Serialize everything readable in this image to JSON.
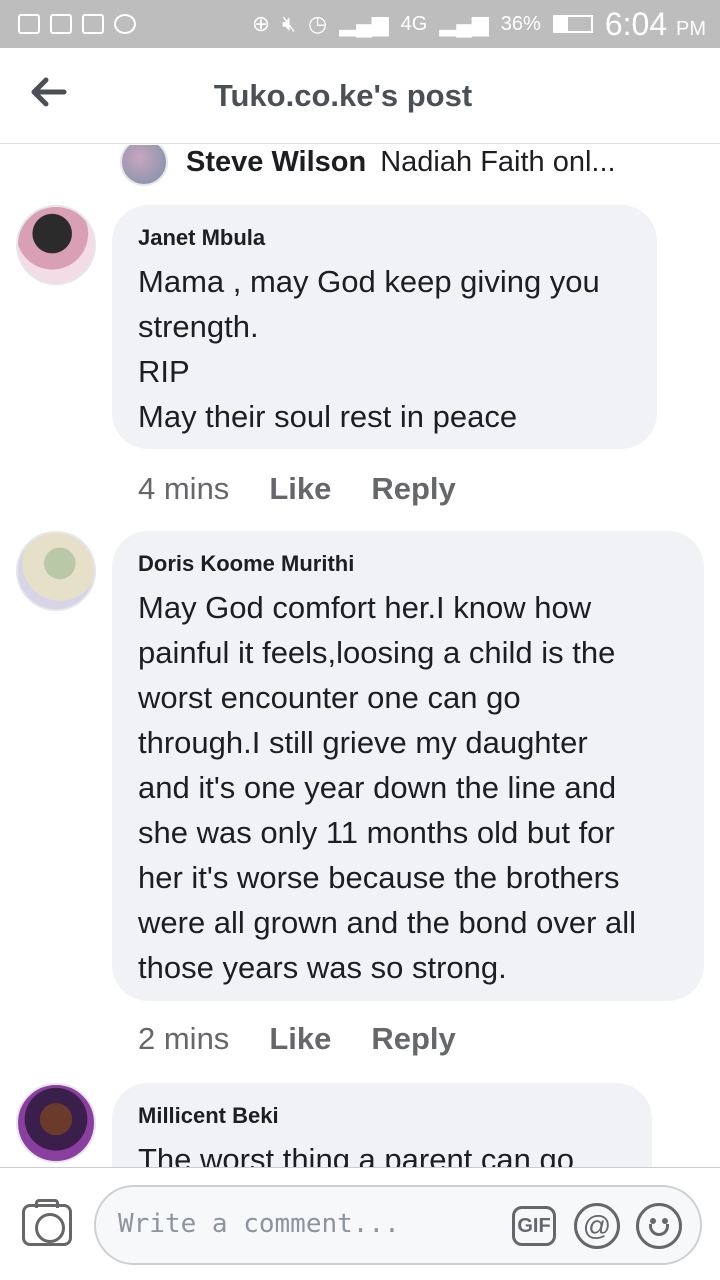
{
  "statusbar": {
    "battery_text": "36%",
    "battery_level": 0.36,
    "time": "6:04",
    "ampm": "PM",
    "network": "4G"
  },
  "header": {
    "title": "Tuko.co.ke's post"
  },
  "reply_preview": {
    "name": "Steve Wilson",
    "text": "Nadiah Faith onl..."
  },
  "comments": [
    {
      "author": "Janet Mbula",
      "text": "Mama , may God keep giving you\nstrength.\nRIP\nMay their soul rest in peace",
      "time": "4 mins",
      "like": "Like",
      "reply": "Reply"
    },
    {
      "author": "Doris Koome Murithi",
      "text": "May God comfort her.I know how\npainful it feels,loosing a child is the\nworst encounter one can go\nthrough.I still grieve my daughter\nand it's one year down the line and\nshe was only 11 months old but for\nher it's worse because the brothers\nwere all grown and the bond over all\nthose years was so strong.",
      "time": "2 mins",
      "like": "Like",
      "reply": "Reply"
    },
    {
      "author": "Millicent Beki",
      "text": "The worst thing a parent can go"
    }
  ],
  "composer": {
    "placeholder": "Write a comment...",
    "gif_label": "GIF",
    "at_label": "@"
  }
}
